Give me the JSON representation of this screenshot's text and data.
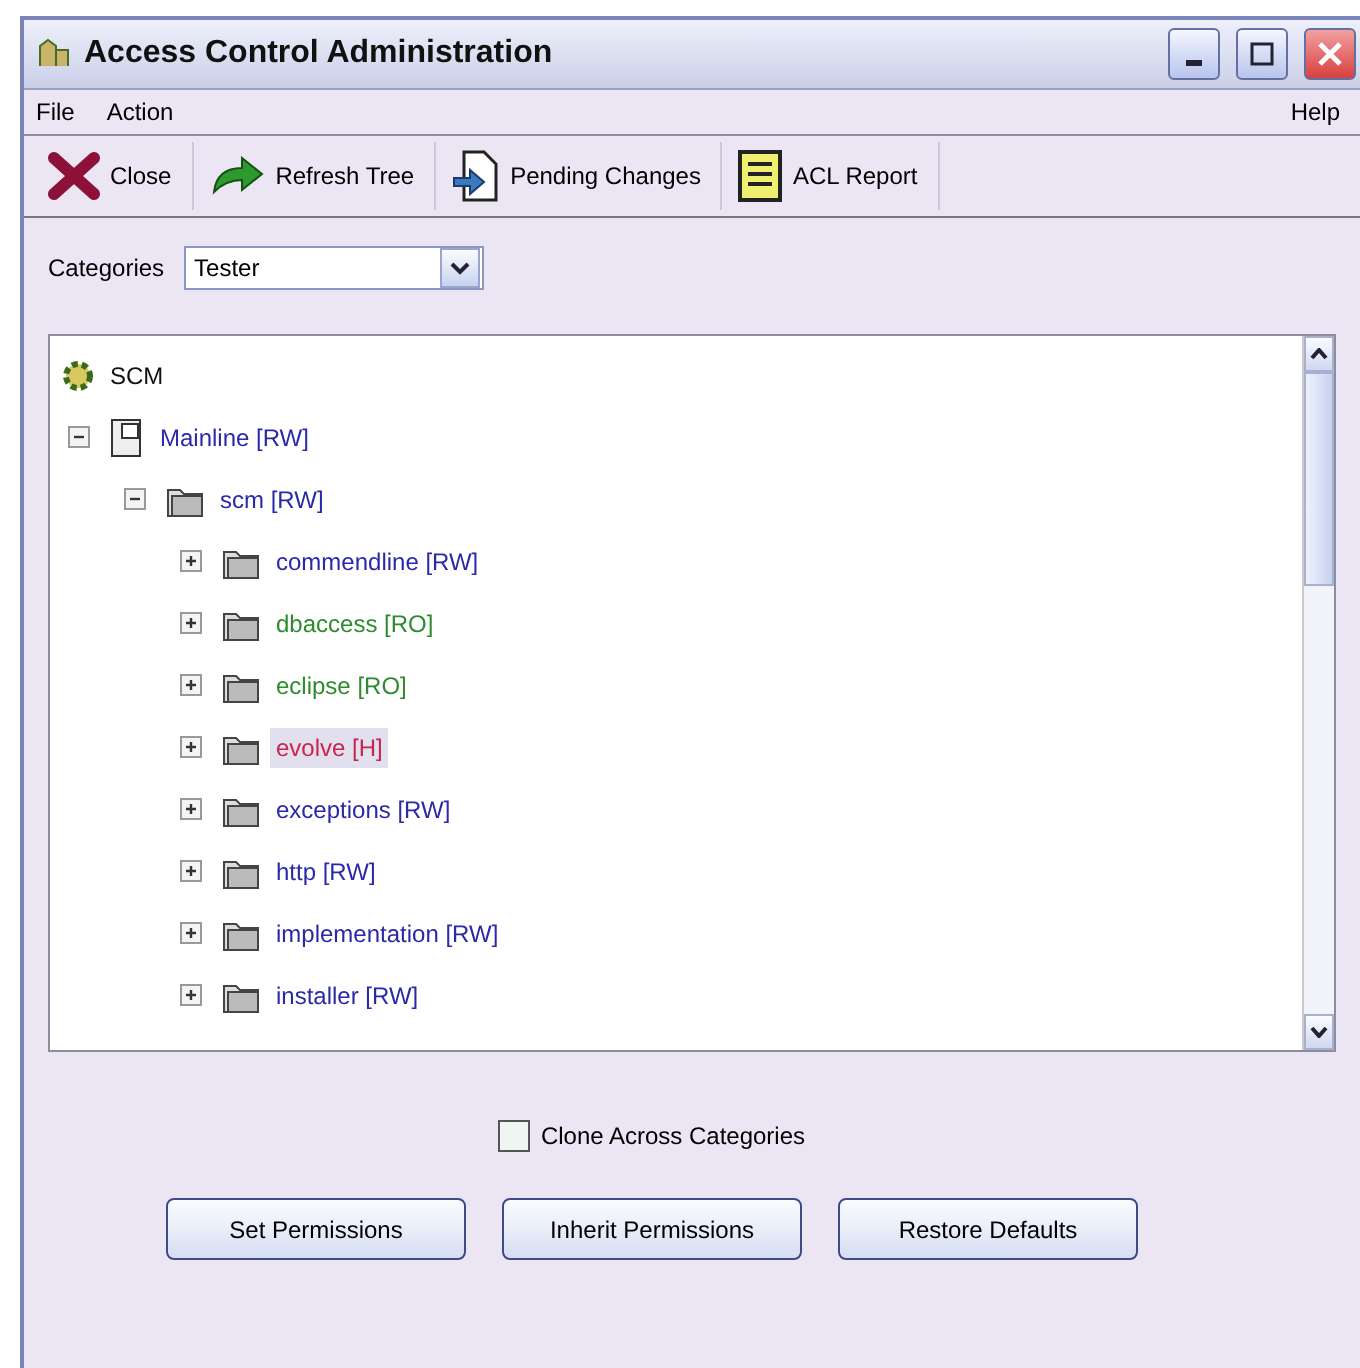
{
  "window": {
    "title": "Access Control Administration"
  },
  "menu": [
    {
      "label": "File"
    },
    {
      "label": "Action"
    },
    {
      "label": "Help"
    }
  ],
  "toolbar": [
    {
      "label": "Close",
      "kind": "close"
    },
    {
      "label": "Refresh Tree",
      "kind": "refresh"
    },
    {
      "label": "Pending Changes",
      "kind": "pending"
    },
    {
      "label": "ACL Report",
      "kind": "report"
    }
  ],
  "categories": {
    "label": "Categories",
    "value": "Tester"
  },
  "tree": {
    "label": "SCM",
    "children": [
      {
        "label": "Mainline [RW]",
        "kind": "branch",
        "color": "#2a2aa8",
        "expanded": true,
        "selected": false,
        "children": [
          {
            "label": "scm [RW]",
            "kind": "folder",
            "color": "#2a2aa8",
            "expanded": true,
            "selected": false,
            "children": [
              {
                "label": "commendline [RW]",
                "kind": "folder",
                "color": "#2a2aa8",
                "expanded": false,
                "selected": false
              },
              {
                "label": "dbaccess [RO]",
                "kind": "folder",
                "color": "#2e8b2e",
                "expanded": false,
                "selected": false
              },
              {
                "label": "eclipse [RO]",
                "kind": "folder",
                "color": "#2e8b2e",
                "expanded": false,
                "selected": false
              },
              {
                "label": "evolve [H]",
                "kind": "folder",
                "color": "#c8264e",
                "expanded": false,
                "selected": true
              },
              {
                "label": "exceptions [RW]",
                "kind": "folder",
                "color": "#2a2aa8",
                "expanded": false,
                "selected": false
              },
              {
                "label": "http [RW]",
                "kind": "folder",
                "color": "#2a2aa8",
                "expanded": false,
                "selected": false
              },
              {
                "label": "implementation [RW]",
                "kind": "folder",
                "color": "#2a2aa8",
                "expanded": false,
                "selected": false
              },
              {
                "label": "installer [RW]",
                "kind": "folder",
                "color": "#2a2aa8",
                "expanded": false,
                "selected": false
              }
            ]
          }
        ]
      }
    ]
  },
  "clone_checkbox": {
    "label": "Clone Across Categories",
    "checked": false
  },
  "buttons": [
    {
      "label": "Set Permissions"
    },
    {
      "label": "Inherit Permissions"
    },
    {
      "label": "Restore Defaults"
    }
  ]
}
